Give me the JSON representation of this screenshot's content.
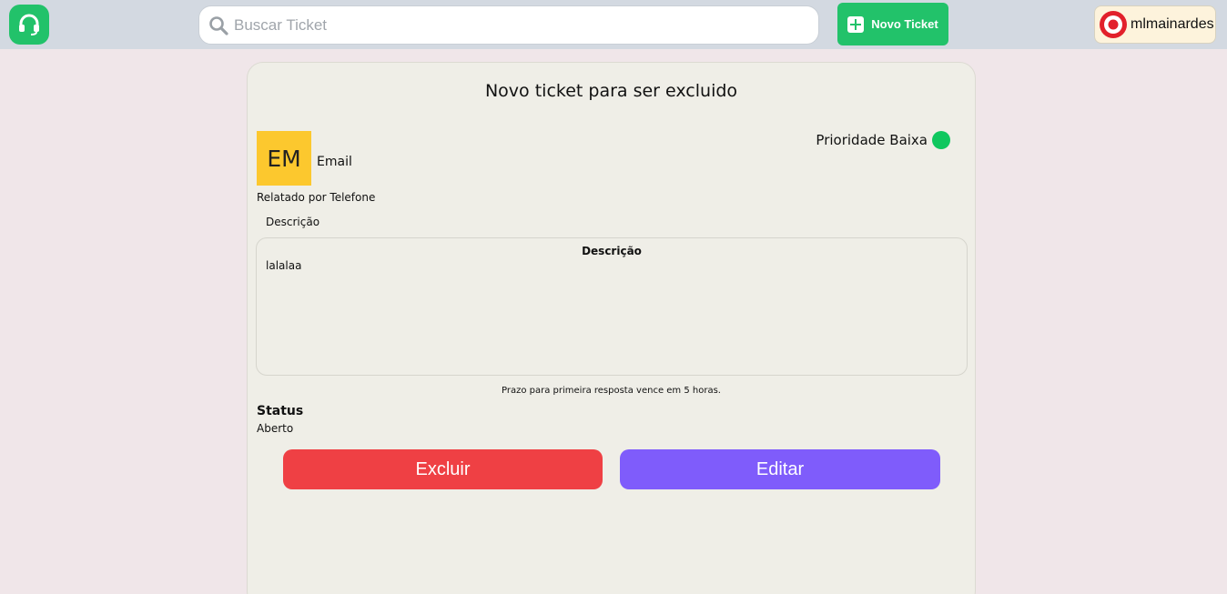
{
  "header": {
    "logo_icon": "headset-icon",
    "search_placeholder": "Buscar Ticket",
    "search_icon": "search-icon",
    "new_ticket_label": "Novo Ticket",
    "new_ticket_icon": "plus-square-icon",
    "username": "mlmainardes",
    "user_icon": "target-avatar-icon"
  },
  "ticket": {
    "title": "Novo ticket para ser excluido",
    "avatar_initials": "EM",
    "channel": "Email",
    "priority_label": "Prioridade Baixa",
    "priority_color": "#0fc75e",
    "reported_by": "Relatado por Telefone",
    "description_label": "Descrição",
    "description_box_title": "Descrição",
    "description_text": "lalalaa",
    "deadline_text": "Prazo para primeira resposta vence em 5 horas.",
    "status_label": "Status",
    "status_value": "Aberto"
  },
  "actions": {
    "delete_label": "Excluir",
    "delete_color": "#ef4044",
    "edit_label": "Editar",
    "edit_color": "#7f5cfb"
  },
  "colors": {
    "brand_green": "#22c26a",
    "avatar_yellow": "#fcc82e"
  }
}
